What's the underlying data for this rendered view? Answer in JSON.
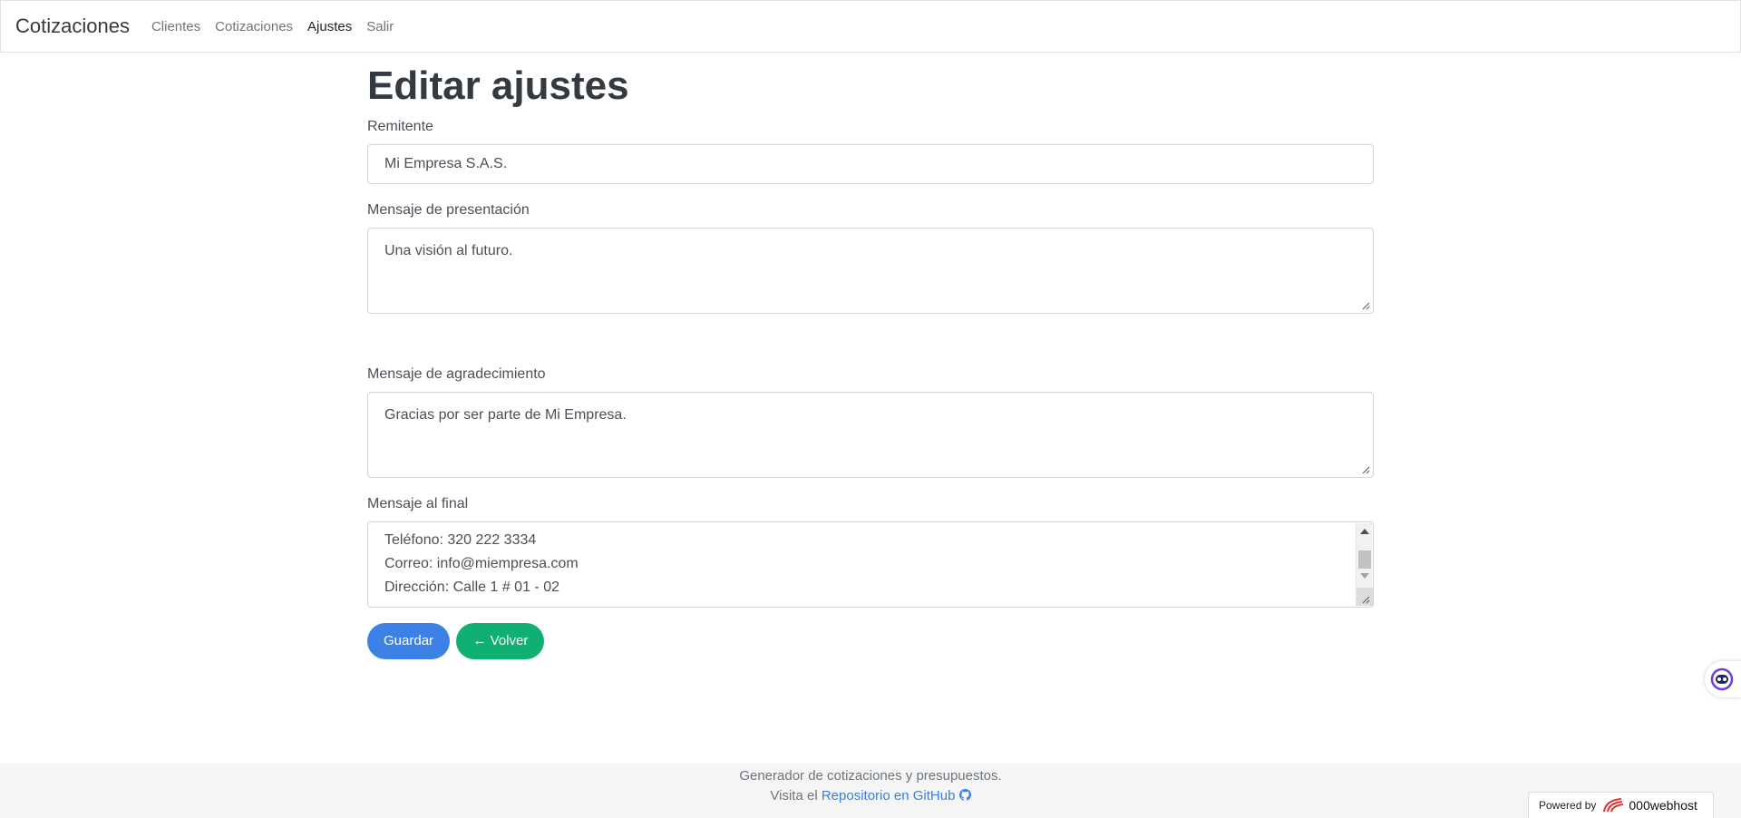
{
  "navbar": {
    "brand": "Cotizaciones",
    "links": [
      {
        "label": "Clientes",
        "active": false
      },
      {
        "label": "Cotizaciones",
        "active": false
      },
      {
        "label": "Ajustes",
        "active": true
      },
      {
        "label": "Salir",
        "active": false
      }
    ]
  },
  "page": {
    "title": "Editar ajustes"
  },
  "form": {
    "remitente_label": "Remitente",
    "remitente_value": "Mi Empresa S.A.S.",
    "presentacion_label": "Mensaje de presentación",
    "presentacion_value": "Una visión al futuro.",
    "agradecimiento_label": "Mensaje de agradecimiento",
    "agradecimiento_value": "Gracias por ser parte de Mi Empresa.",
    "final_label": "Mensaje al final",
    "final_lines": [
      "Teléfono: 320 222 3334",
      "Correo: info@miempresa.com",
      "Dirección: Calle 1 # 01 - 02"
    ],
    "save_label": "Guardar",
    "back_label": "← Volver"
  },
  "footer": {
    "line1": "Generador de cotizaciones y presupuestos.",
    "line2_prefix": "Visita el",
    "repo_link": "Repositorio en GitHub"
  },
  "powered": {
    "prefix": "Powered by",
    "brand": "000webhost"
  },
  "colors": {
    "primary": "#3c82e6",
    "success": "#10b072",
    "link": "#3d7fd9",
    "footer_bg": "#f5f5f5"
  },
  "icons": [
    "github-icon",
    "webhost-logo-icon",
    "chatbot-icon",
    "resize-grip-icon"
  ]
}
